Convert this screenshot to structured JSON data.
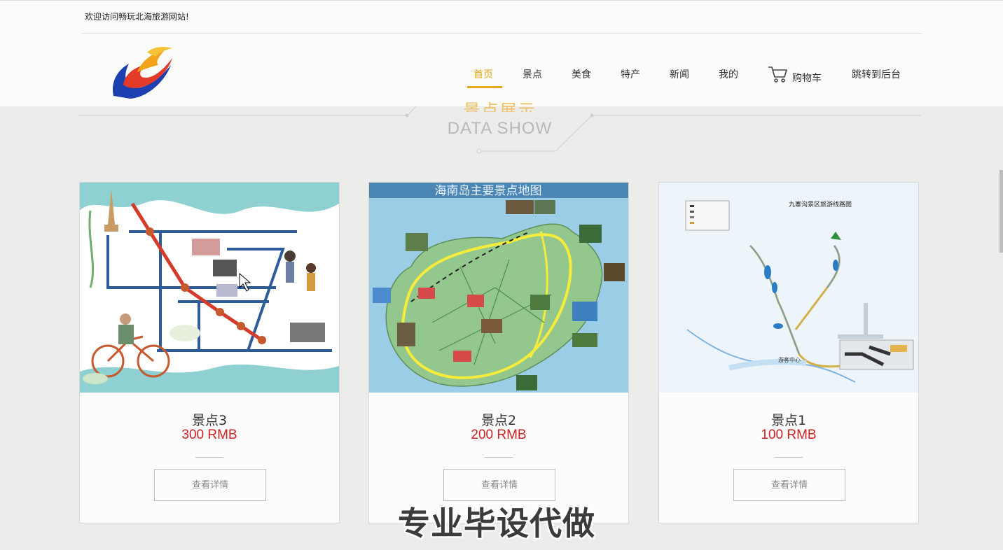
{
  "header": {
    "welcome": "欢迎访问畅玩北海旅游网站!",
    "nav": [
      {
        "label": "首页",
        "active": true
      },
      {
        "label": "景点",
        "active": false
      },
      {
        "label": "美食",
        "active": false
      },
      {
        "label": "特产",
        "active": false
      },
      {
        "label": "新闻",
        "active": false
      },
      {
        "label": "我的",
        "active": false
      },
      {
        "label": "购物车",
        "active": false,
        "icon": "cart-icon"
      },
      {
        "label": "跳转到后台",
        "active": false
      }
    ],
    "accent_color": "#e3a81b"
  },
  "section": {
    "title_cn": "景点展示",
    "title_en": "DATA SHOW"
  },
  "cards": [
    {
      "name": "景点3",
      "price": "300 RMB",
      "button": "查看详情"
    },
    {
      "name": "景点2",
      "price": "200 RMB",
      "button": "查看详情",
      "map_title": "海南岛主要景点地图"
    },
    {
      "name": "景点1",
      "price": "100 RMB",
      "button": "查看详情",
      "map_title": "九寨沟景区旅游线路图"
    }
  ],
  "price_color": "#d21f1f",
  "watermark": "专业毕设代做"
}
